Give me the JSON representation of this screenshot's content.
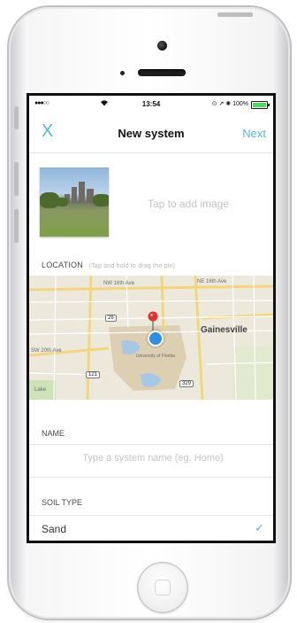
{
  "status_bar": {
    "signal": "●●●○○",
    "wifi_icon": "wifi-icon",
    "time": "13:54",
    "indicators": "⊙ ↗ ✺ 100%",
    "battery_percent": 100
  },
  "nav": {
    "close_label": "X",
    "title": "New system",
    "next_label": "Next"
  },
  "image": {
    "add_image_label": "Tap to add image"
  },
  "location": {
    "label": "LOCATION",
    "hint": "(Tap and hold to drag the pin)",
    "map": {
      "city": "Gainesville",
      "streets": [
        "NW 16th Ave",
        "NE 16th Ave",
        "SW 20th Ave"
      ],
      "campus": "University of Florida",
      "road_labels": [
        "26",
        "121",
        "329"
      ],
      "lake_label": "Lake"
    }
  },
  "name": {
    "label": "NAME",
    "value": "",
    "placeholder": "Type a system name (eg. Home)"
  },
  "soil": {
    "label": "SOIL TYPE",
    "options": [
      {
        "label": "Sand",
        "selected": true
      }
    ]
  },
  "colors": {
    "accent": "#5db3e6",
    "map_background": "#ece8dc",
    "pin_red": "#e2302a",
    "location_blue": "#2f8fe0"
  }
}
